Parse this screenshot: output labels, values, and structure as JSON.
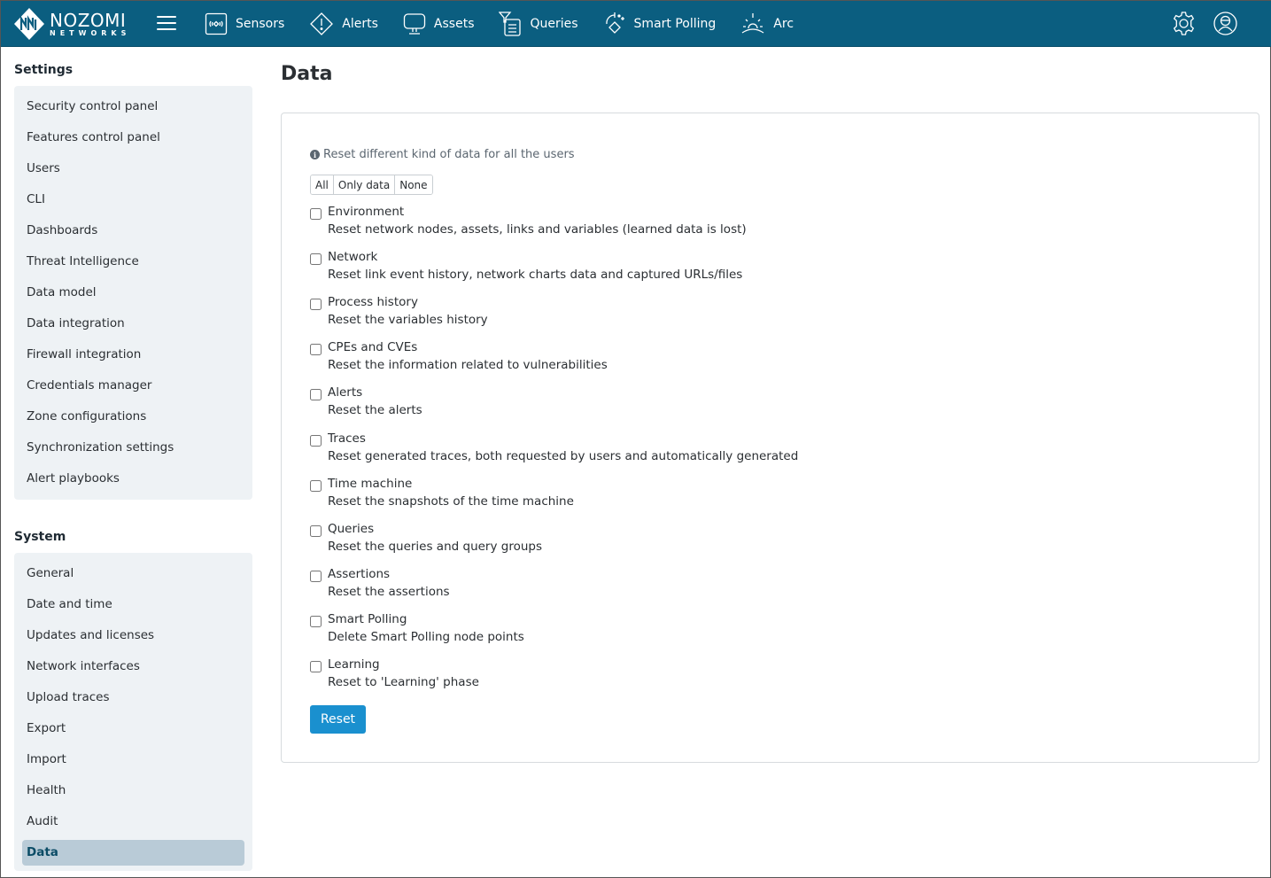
{
  "brand": {
    "line1": "NOZOMI",
    "line2": "NETWORKS",
    "color": "#0b5e80"
  },
  "nav": [
    {
      "label": "Sensors",
      "icon": "sensors-icon"
    },
    {
      "label": "Alerts",
      "icon": "alert-diamond-icon"
    },
    {
      "label": "Assets",
      "icon": "monitor-icon"
    },
    {
      "label": "Queries",
      "icon": "queries-icon"
    },
    {
      "label": "Smart Polling",
      "icon": "smart-polling-icon"
    },
    {
      "label": "Arc",
      "icon": "arc-icon"
    }
  ],
  "top_right": [
    "gear-icon",
    "user-avatar-icon"
  ],
  "sidebar": {
    "settings_title": "Settings",
    "settings_items": [
      "Security control panel",
      "Features control panel",
      "Users",
      "CLI",
      "Dashboards",
      "Threat Intelligence",
      "Data model",
      "Data integration",
      "Firewall integration",
      "Credentials manager",
      "Zone configurations",
      "Synchronization settings",
      "Alert playbooks"
    ],
    "system_title": "System",
    "system_items": [
      "General",
      "Date and time",
      "Updates and licenses",
      "Network interfaces",
      "Upload traces",
      "Export",
      "Import",
      "Health",
      "Audit",
      "Data"
    ],
    "active": "Data"
  },
  "main": {
    "title": "Data",
    "info": "Reset different kind of data for all the users",
    "select_buttons": [
      "All",
      "Only data",
      "None"
    ],
    "options": [
      {
        "label": "Environment",
        "desc": "Reset network nodes, assets, links and variables (learned data is lost)",
        "checked": false
      },
      {
        "label": "Network",
        "desc": "Reset link event history, network charts data and captured URLs/files",
        "checked": false
      },
      {
        "label": "Process history",
        "desc": "Reset the variables history",
        "checked": false
      },
      {
        "label": "CPEs and CVEs",
        "desc": "Reset the information related to vulnerabilities",
        "checked": false
      },
      {
        "label": "Alerts",
        "desc": "Reset the alerts",
        "checked": false
      },
      {
        "label": "Traces",
        "desc": "Reset generated traces, both requested by users and automatically generated",
        "checked": false
      },
      {
        "label": "Time machine",
        "desc": "Reset the snapshots of the time machine",
        "checked": false
      },
      {
        "label": "Queries",
        "desc": "Reset the queries and query groups",
        "checked": false
      },
      {
        "label": "Assertions",
        "desc": "Reset the assertions",
        "checked": false
      },
      {
        "label": "Smart Polling",
        "desc": "Delete Smart Polling node points",
        "checked": false
      },
      {
        "label": "Learning",
        "desc": "Reset to 'Learning' phase",
        "checked": false
      }
    ],
    "reset_label": "Reset",
    "reset_color": "#1a90cf"
  }
}
